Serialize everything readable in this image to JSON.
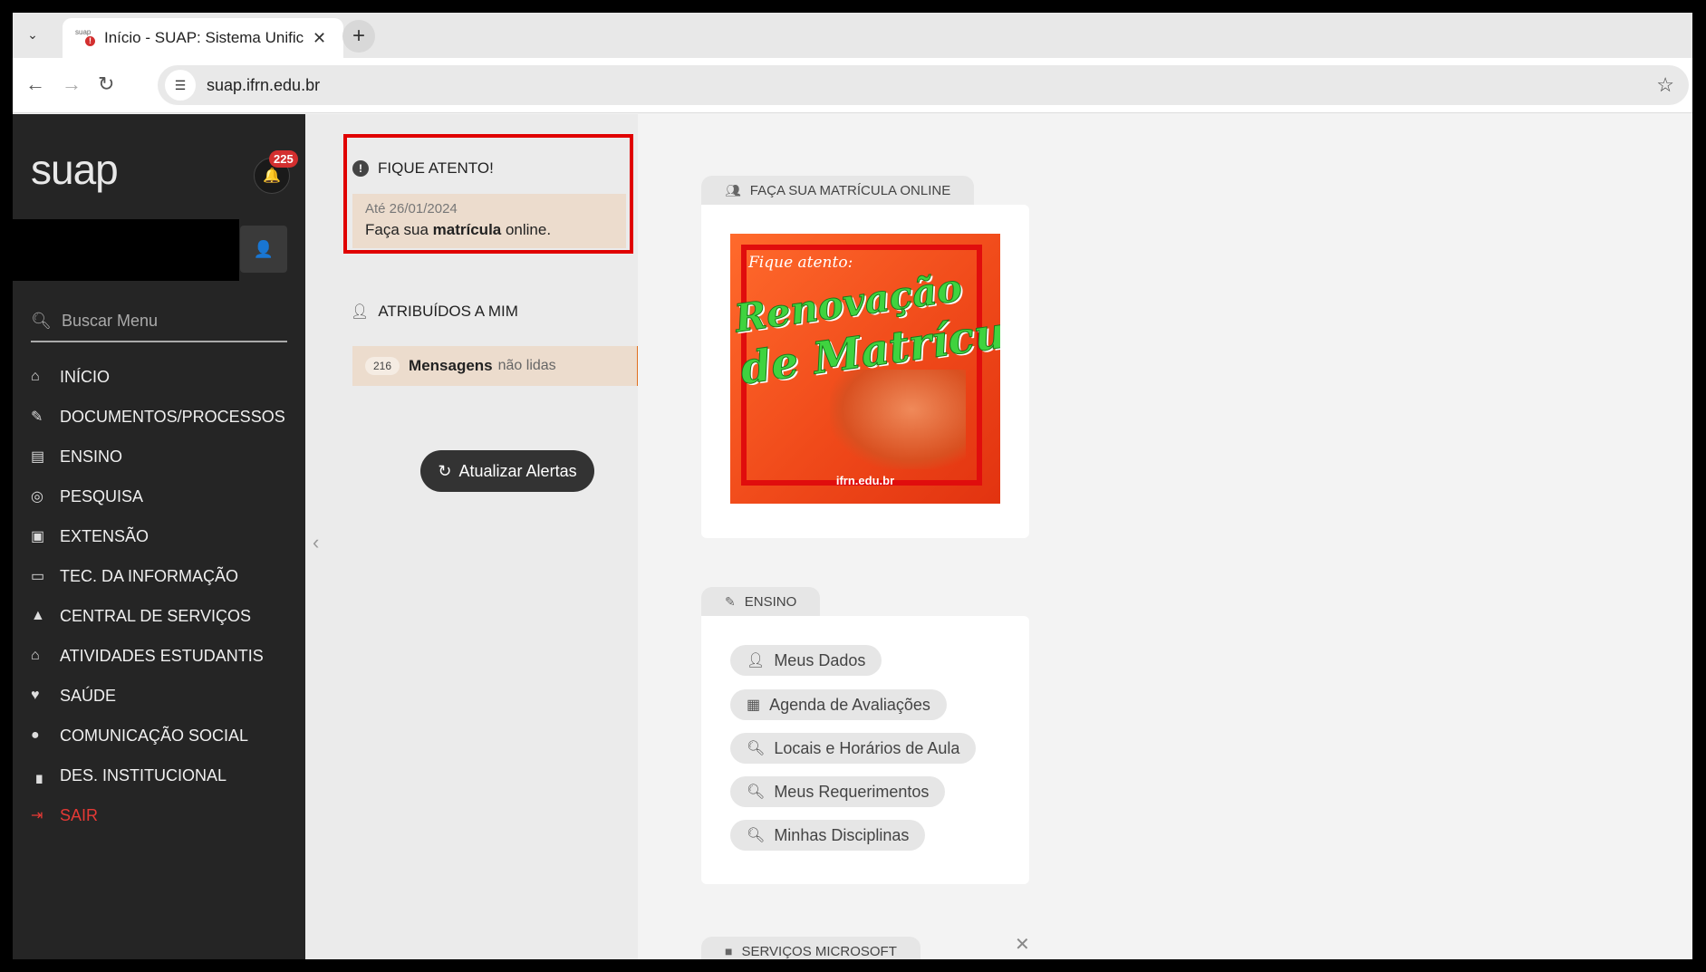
{
  "browser": {
    "tab_title": "Início - SUAP: Sistema Unificado",
    "favicon_text": "suap",
    "favicon_badge": "!",
    "url": "suap.ifrn.edu.br"
  },
  "sidebar": {
    "logo": "suap",
    "notification_count": "225",
    "search_placeholder": "Buscar Menu",
    "items": [
      {
        "label": "INÍCIO",
        "icon": "home-icon"
      },
      {
        "label": "DOCUMENTOS/PROCESSOS",
        "icon": "document-icon"
      },
      {
        "label": "ENSINO",
        "icon": "teach-icon"
      },
      {
        "label": "PESQUISA",
        "icon": "globe-icon"
      },
      {
        "label": "EXTENSÃO",
        "icon": "briefcase-icon"
      },
      {
        "label": "TEC. DA INFORMAÇÃO",
        "icon": "laptop-icon"
      },
      {
        "label": "CENTRAL DE SERVIÇOS",
        "icon": "bell-service-icon"
      },
      {
        "label": "ATIVIDADES ESTUDANTIS",
        "icon": "graduation-cap-icon"
      },
      {
        "label": "SAÚDE",
        "icon": "heartbeat-icon"
      },
      {
        "label": "COMUNICAÇÃO SOCIAL",
        "icon": "comment-icon"
      },
      {
        "label": "DES. INSTITUCIONAL",
        "icon": "chart-icon"
      },
      {
        "label": "SAIR",
        "icon": "sign-out-icon"
      }
    ]
  },
  "alerts": {
    "fique_title": "FIQUE ATENTO!",
    "fique_date": "Até 26/01/2024",
    "fique_msg_pre": "Faça sua ",
    "fique_msg_bold": "matrícula",
    "fique_msg_post": " online.",
    "atribuidos_title": "ATRIBUÍDOS A MIM",
    "messages_count": "216",
    "messages_label": "Mensagens",
    "messages_sub": "não lidas",
    "refresh_label": "Atualizar Alertas"
  },
  "main": {
    "matricula_box_title": "FAÇA SUA MATRÍCULA ONLINE",
    "banner": {
      "line1": "Fique atento:",
      "line2": "Renovação",
      "line3": "de Matrícula",
      "site": "ifrn.edu.br"
    },
    "ensino_box_title": "ENSINO",
    "ensino_buttons": [
      {
        "label": "Meus Dados",
        "icon": "user-icon"
      },
      {
        "label": "Agenda de Avaliações",
        "icon": "calendar-icon"
      },
      {
        "label": "Locais e Horários de Aula",
        "icon": "search-icon"
      },
      {
        "label": "Meus Requerimentos",
        "icon": "search-icon"
      },
      {
        "label": "Minhas Disciplinas",
        "icon": "search-icon"
      }
    ],
    "microsoft_box_title": "SERVIÇOS MICROSOFT"
  }
}
